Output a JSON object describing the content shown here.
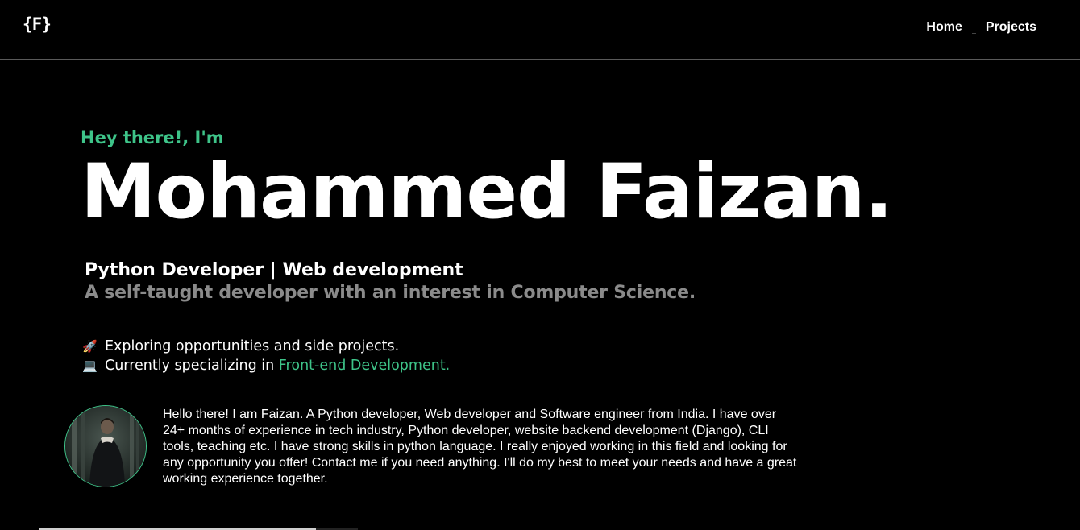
{
  "header": {
    "logo": "{F}",
    "nav": [
      {
        "label": "Home"
      },
      {
        "label": "Projects"
      }
    ]
  },
  "hero": {
    "greeting": "Hey there!, I'm",
    "name": "Mohammed Faizan.",
    "role": "Python Developer | Web development",
    "tagline": "A self-taught developer with an interest in Computer Science."
  },
  "points": [
    {
      "emoji": "🚀",
      "text": "Exploring opportunities and side projects.",
      "accent": ""
    },
    {
      "emoji": "💻",
      "text": "Currently specializing in ",
      "accent": "Front-end Development."
    }
  ],
  "about": {
    "text": "Hello there! I am Faizan. A Python developer, Web developer and Software engineer from India. I have over 24+ months of experience in tech industry, Python developer, website backend development (Django), CLI tools, teaching etc. I have strong skills in python language. I really enjoyed working in this field and looking for any opportunity you offer! Contact me if you need anything. I'll do my best to meet your needs and have a great working experience together."
  },
  "colors": {
    "background": "#000000",
    "accent": "#3ec489",
    "muted": "#8b8b8b"
  }
}
